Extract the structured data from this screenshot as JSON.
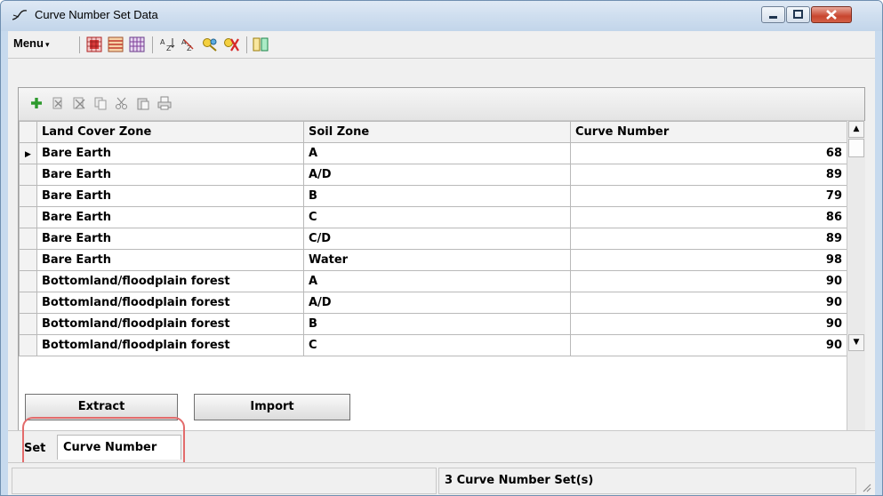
{
  "window": {
    "title": "Curve Number Set Data",
    "icon": "curve-app-icon",
    "controls": [
      "minimize-icon",
      "maximize-icon",
      "close-icon"
    ]
  },
  "toolbar": {
    "menu_label": "Menu",
    "icons": [
      "grid-red-icon",
      "grid-rows-icon",
      "grid-columns-icon",
      "sort-az-icon",
      "sort-za-icon",
      "key-search-icon",
      "clear-filter-icon",
      "columns-toggle-icon"
    ]
  },
  "grid_toolbar": {
    "icons": [
      "add-row-icon",
      "delete-row-icon",
      "delete-all-icon",
      "copy-icon",
      "cut-icon",
      "paste-icon",
      "print-icon"
    ]
  },
  "table": {
    "columns": [
      "Land Cover Zone",
      "Soil Zone",
      "Curve Number"
    ],
    "rows": [
      {
        "land_cover": "Bare Earth",
        "soil": "A",
        "cn": "68"
      },
      {
        "land_cover": "Bare Earth",
        "soil": "A/D",
        "cn": "89"
      },
      {
        "land_cover": "Bare Earth",
        "soil": "B",
        "cn": "79"
      },
      {
        "land_cover": "Bare Earth",
        "soil": "C",
        "cn": "86"
      },
      {
        "land_cover": "Bare Earth",
        "soil": "C/D",
        "cn": "89"
      },
      {
        "land_cover": "Bare Earth",
        "soil": "Water",
        "cn": "98"
      },
      {
        "land_cover": "Bottomland/floodplain forest",
        "soil": "A",
        "cn": "90"
      },
      {
        "land_cover": "Bottomland/floodplain forest",
        "soil": "A/D",
        "cn": "90"
      },
      {
        "land_cover": "Bottomland/floodplain forest",
        "soil": "B",
        "cn": "90"
      },
      {
        "land_cover": "Bottomland/floodplain forest",
        "soil": "C",
        "cn": "90"
      }
    ],
    "current_row": 0
  },
  "buttons": {
    "extract": "Extract",
    "import": "Import"
  },
  "tabs": {
    "set_label": "Set",
    "active_tab": "Curve Number"
  },
  "status": {
    "count_text": "3 Curve Number Set(s)"
  },
  "colors": {
    "highlight": "#e36b6b",
    "add_green": "#2e9a2e",
    "close_red": "#c8462f"
  }
}
